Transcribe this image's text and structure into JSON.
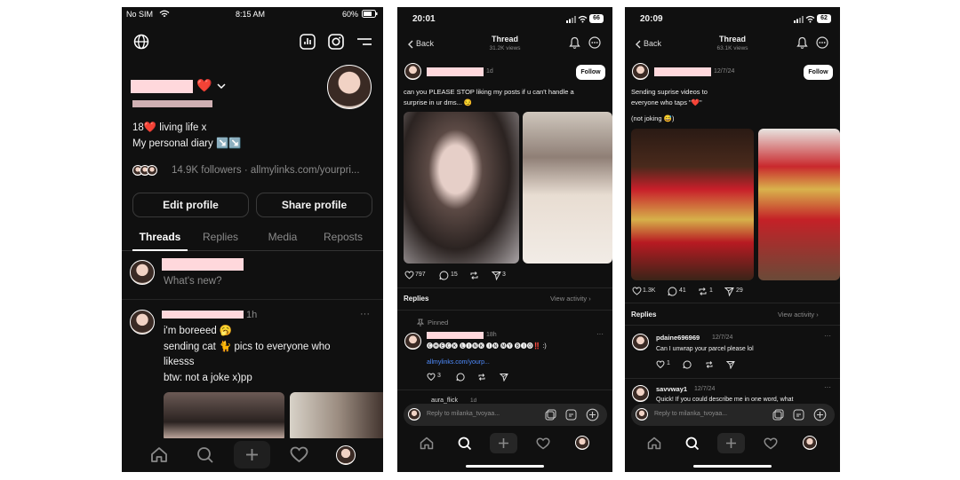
{
  "screen1": {
    "status": {
      "carrier": "No SIM",
      "time": "8:15 AM",
      "battery": "60%"
    },
    "profile": {
      "heart": "❤️",
      "bio_line1": "18❤️ living life x",
      "bio_line2": "My personal diary ↘️↘️",
      "followers_text": "14.9K followers · allmylinks.com/yourpri...",
      "edit_button": "Edit profile",
      "share_button": "Share profile"
    },
    "tabs": [
      "Threads",
      "Replies",
      "Media",
      "Reposts"
    ],
    "composer_placeholder": "What's new?",
    "post": {
      "time": "1h",
      "more": "···",
      "line1": "i'm boreeed 🥱",
      "line2": "sending cat 🐈 pics to everyone who",
      "line3": "likesss",
      "line4": "btw: not a joke x)pp"
    }
  },
  "screen2": {
    "status": {
      "time": "20:01",
      "battery": "66"
    },
    "header": {
      "back": "Back",
      "title": "Thread",
      "views": "31.2K views"
    },
    "post": {
      "time": "1d",
      "follow": "Follow",
      "text_line1": "can you PLEASE STOP liking my posts if u can't handle a",
      "text_line2": "surprise in ur dms... 😏",
      "likes": "797",
      "comments": "15",
      "shares": "3"
    },
    "replies_label": "Replies",
    "view_activity": "View activity ›",
    "pinned_label": "Pinned",
    "reply": {
      "time": "18h",
      "text": "🅒🅗🅔🅒🅚 🅛🅘🅝🅚 🅘🅝 🅜🅨 🅑🅘🅞‼️ :)",
      "link": "allmylinks.com/yourp...",
      "count": "3"
    },
    "next_reply_user": "aura_flick",
    "next_reply_time": "1d",
    "reply_placeholder": "Reply to milanka_tvoyaa..."
  },
  "screen3": {
    "status": {
      "time": "20:09",
      "battery": "62"
    },
    "header": {
      "back": "Back",
      "title": "Thread",
      "views": "63.1K views"
    },
    "post": {
      "time": "12/7/24",
      "follow": "Follow",
      "text_line1": "Sending suprise videos to",
      "text_line2": "everyone who taps \"❤️\"",
      "text_line3": "(not joking 😅)",
      "likes": "1.3K",
      "comments": "41",
      "reposts": "1",
      "shares": "29"
    },
    "replies_label": "Replies",
    "view_activity": "View activity ›",
    "reply1": {
      "user": "pdaine696969",
      "time": "12/7/24",
      "text": "Can I unwrap your parcel please lol",
      "likes": "1"
    },
    "reply2": {
      "user": "savvway1",
      "time": "12/7/24",
      "text": "Quick! If you could describe me in one word, what"
    },
    "reply_placeholder": "Reply to milanka_tvoyaa..."
  },
  "colors": {
    "background": "#101010",
    "redacted": "#ffd8dc",
    "link": "#4f8cff",
    "muted": "#8a8a8a"
  }
}
